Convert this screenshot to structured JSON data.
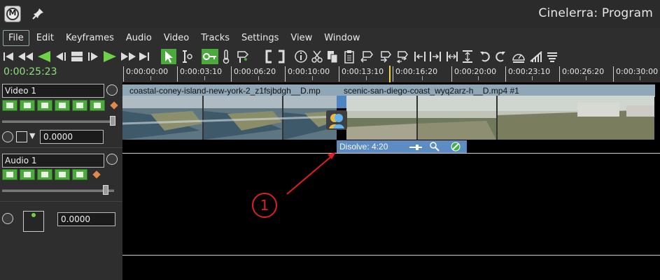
{
  "window": {
    "title": "Cinelerra: Program"
  },
  "menu": [
    "File",
    "Edit",
    "Keyframes",
    "Audio",
    "Video",
    "Tracks",
    "Settings",
    "View",
    "Window"
  ],
  "timecode": "0:00:25:23",
  "ruler": {
    "labels": [
      "0:00:00:00",
      "0:00:03:10",
      "0:00:06:20",
      "0:00:10:00",
      "0:00:13:10",
      "0:00:16:20",
      "0:00:20:00",
      "0:00:23:10",
      "0:00:26:20",
      "0:00:30:00"
    ]
  },
  "tracks": {
    "video": {
      "name": "Video 1",
      "value": "0.0000"
    },
    "audio": {
      "name": "Audio 1",
      "value": "0.0000"
    }
  },
  "clips": {
    "clip1": "coastal-coney-island-new-york-2_z1fsjbdgh__D.mp",
    "clip2": "scenic-san-diego-coast_wyq2arz-h__D.mp4 #1"
  },
  "transition": {
    "label": "Disolve: 4:20"
  },
  "annotation": {
    "number": "1",
    "color": "#e02020"
  },
  "colors": {
    "accent_green": "#4caa3c",
    "timecode_green": "#8fe07a",
    "transition_blue": "#5d8cc2",
    "clip_bar": "#8fa7b6"
  }
}
